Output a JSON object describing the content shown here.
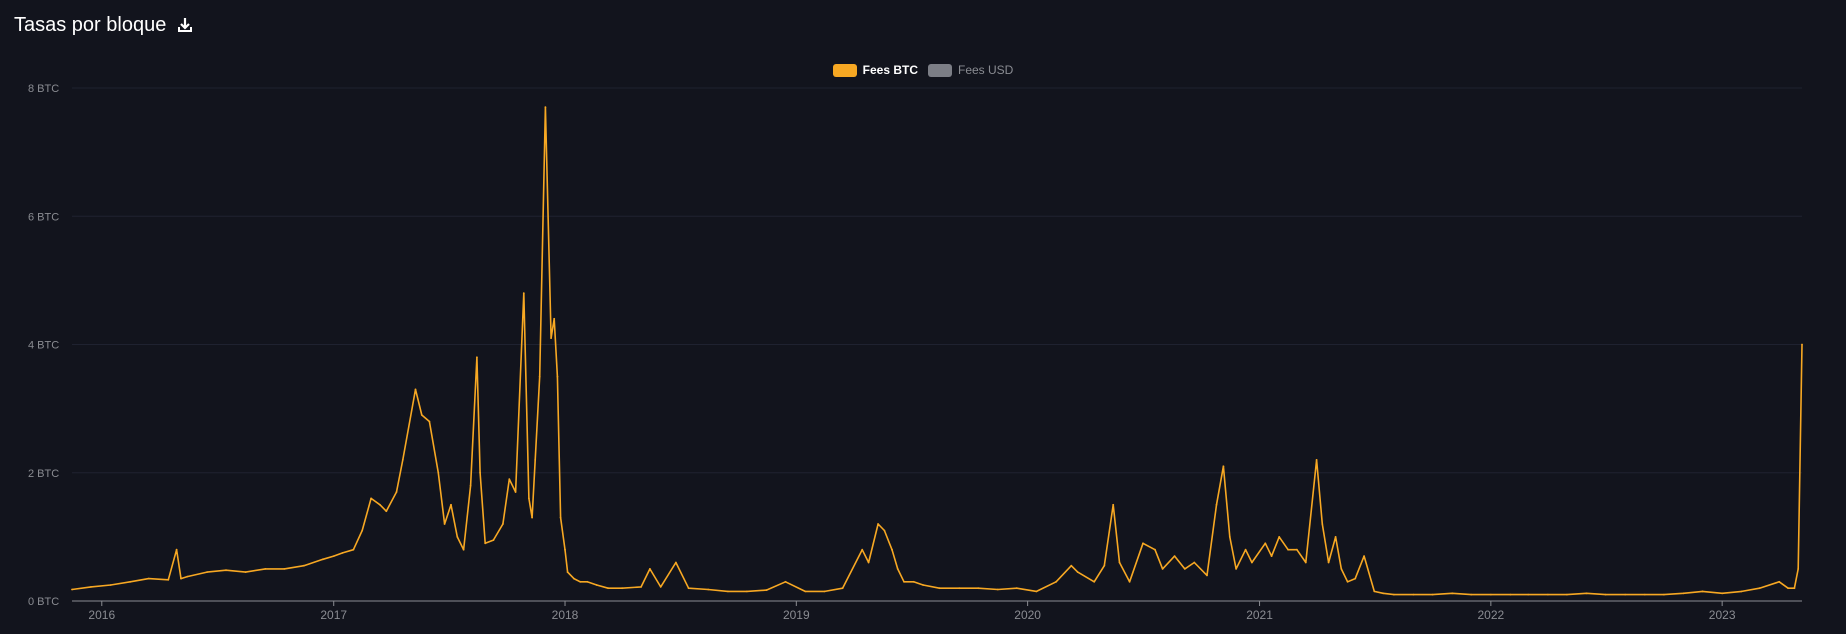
{
  "header": {
    "title": "Tasas por bloque",
    "download_icon": "download-icon"
  },
  "legend": [
    {
      "label": "Fees BTC",
      "color": "#f7a823",
      "active": true
    },
    {
      "label": "Fees USD",
      "color": "#7c7e86",
      "active": false
    }
  ],
  "chart_data": {
    "type": "line",
    "title": "",
    "xlabel": "",
    "ylabel": "",
    "xlim": [
      "2015-11-15",
      "2023-05-07"
    ],
    "ylim": [
      0,
      8
    ],
    "y_ticks": [
      "0 BTC",
      "2 BTC",
      "4 BTC",
      "6 BTC",
      "8 BTC"
    ],
    "x_ticks": [
      "2016",
      "2017",
      "2018",
      "2019",
      "2020",
      "2021",
      "2022",
      "2023"
    ],
    "grid": true,
    "legend_position": "top-center",
    "series": [
      {
        "name": "Fees BTC",
        "color": "#f7a823",
        "x": [
          "2015-11-15",
          "2015-12-15",
          "2016-01-15",
          "2016-02-15",
          "2016-03-15",
          "2016-04-15",
          "2016-04-28",
          "2016-05-05",
          "2016-05-15",
          "2016-06-15",
          "2016-07-15",
          "2016-08-15",
          "2016-09-15",
          "2016-10-15",
          "2016-11-15",
          "2016-12-15",
          "2017-01-01",
          "2017-01-15",
          "2017-02-01",
          "2017-02-15",
          "2017-03-01",
          "2017-03-15",
          "2017-03-25",
          "2017-04-10",
          "2017-04-20",
          "2017-05-10",
          "2017-05-20",
          "2017-06-01",
          "2017-06-15",
          "2017-06-25",
          "2017-07-05",
          "2017-07-15",
          "2017-07-25",
          "2017-08-05",
          "2017-08-15",
          "2017-08-20",
          "2017-08-28",
          "2017-09-10",
          "2017-09-25",
          "2017-10-05",
          "2017-10-15",
          "2017-10-28",
          "2017-11-05",
          "2017-11-10",
          "2017-11-15",
          "2017-11-22",
          "2017-12-01",
          "2017-12-10",
          "2017-12-15",
          "2017-12-20",
          "2017-12-25",
          "2018-01-01",
          "2018-01-05",
          "2018-01-15",
          "2018-01-25",
          "2018-02-05",
          "2018-02-20",
          "2018-03-10",
          "2018-04-01",
          "2018-05-01",
          "2018-05-15",
          "2018-06-01",
          "2018-06-25",
          "2018-07-15",
          "2018-08-15",
          "2018-09-15",
          "2018-10-15",
          "2018-11-15",
          "2018-12-15",
          "2019-01-15",
          "2019-02-15",
          "2019-03-15",
          "2019-04-15",
          "2019-04-25",
          "2019-05-10",
          "2019-05-20",
          "2019-06-01",
          "2019-06-10",
          "2019-06-20",
          "2019-07-05",
          "2019-07-20",
          "2019-08-15",
          "2019-09-15",
          "2019-10-15",
          "2019-11-15",
          "2019-12-15",
          "2020-01-15",
          "2020-02-15",
          "2020-03-10",
          "2020-03-20",
          "2020-04-15",
          "2020-05-01",
          "2020-05-15",
          "2020-05-25",
          "2020-06-10",
          "2020-07-01",
          "2020-07-20",
          "2020-08-01",
          "2020-08-20",
          "2020-09-05",
          "2020-09-20",
          "2020-10-10",
          "2020-10-25",
          "2020-11-05",
          "2020-11-15",
          "2020-11-25",
          "2020-12-10",
          "2020-12-20",
          "2021-01-10",
          "2021-01-20",
          "2021-02-01",
          "2021-02-15",
          "2021-03-01",
          "2021-03-15",
          "2021-04-01",
          "2021-04-10",
          "2021-04-20",
          "2021-05-01",
          "2021-05-10",
          "2021-05-20",
          "2021-06-01",
          "2021-06-15",
          "2021-07-01",
          "2021-07-15",
          "2021-08-01",
          "2021-09-01",
          "2021-10-01",
          "2021-11-01",
          "2021-12-01",
          "2022-01-01",
          "2022-02-01",
          "2022-03-01",
          "2022-04-01",
          "2022-05-01",
          "2022-06-01",
          "2022-07-01",
          "2022-08-01",
          "2022-09-01",
          "2022-10-01",
          "2022-11-01",
          "2022-12-01",
          "2023-01-01",
          "2023-02-01",
          "2023-03-01",
          "2023-04-01",
          "2023-04-15",
          "2023-04-25",
          "2023-05-01",
          "2023-05-07"
        ],
        "values": [
          0.18,
          0.22,
          0.25,
          0.3,
          0.35,
          0.33,
          0.8,
          0.35,
          0.38,
          0.45,
          0.48,
          0.45,
          0.5,
          0.5,
          0.55,
          0.65,
          0.7,
          0.75,
          0.8,
          1.1,
          1.6,
          1.5,
          1.4,
          1.7,
          2.2,
          3.3,
          2.9,
          2.8,
          2.0,
          1.2,
          1.5,
          1.0,
          0.8,
          1.8,
          3.8,
          2.0,
          0.9,
          0.95,
          1.2,
          1.9,
          1.7,
          4.8,
          1.6,
          1.3,
          2.2,
          3.5,
          7.7,
          4.1,
          4.4,
          3.5,
          1.3,
          0.8,
          0.45,
          0.35,
          0.3,
          0.3,
          0.25,
          0.2,
          0.2,
          0.22,
          0.5,
          0.22,
          0.6,
          0.2,
          0.18,
          0.15,
          0.15,
          0.17,
          0.3,
          0.15,
          0.15,
          0.2,
          0.8,
          0.6,
          1.2,
          1.1,
          0.8,
          0.5,
          0.3,
          0.3,
          0.25,
          0.2,
          0.2,
          0.2,
          0.18,
          0.2,
          0.15,
          0.3,
          0.55,
          0.45,
          0.3,
          0.55,
          1.5,
          0.6,
          0.3,
          0.9,
          0.8,
          0.5,
          0.7,
          0.5,
          0.6,
          0.4,
          1.5,
          2.1,
          1.0,
          0.5,
          0.8,
          0.6,
          0.9,
          0.7,
          1.0,
          0.8,
          0.8,
          0.6,
          2.2,
          1.2,
          0.6,
          1.0,
          0.5,
          0.3,
          0.35,
          0.7,
          0.15,
          0.12,
          0.1,
          0.1,
          0.1,
          0.12,
          0.1,
          0.1,
          0.1,
          0.1,
          0.1,
          0.1,
          0.12,
          0.1,
          0.1,
          0.1,
          0.1,
          0.12,
          0.15,
          0.12,
          0.15,
          0.2,
          0.3,
          0.2,
          0.2,
          0.5,
          4.0
        ]
      }
    ]
  }
}
